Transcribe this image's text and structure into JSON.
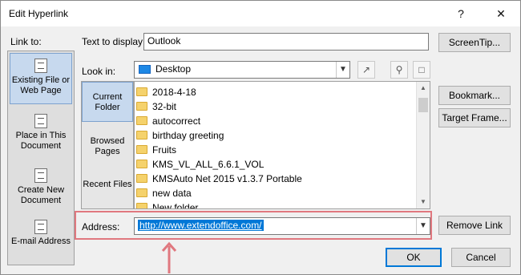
{
  "window": {
    "title": "Edit Hyperlink",
    "help_label": "?",
    "close_label": "✕"
  },
  "link_to": {
    "header": "Link to:",
    "items": [
      {
        "label": "Existing File or Web Page",
        "icon": "web-page-icon",
        "selected": true
      },
      {
        "label": "Place in This Document",
        "icon": "document-place-icon",
        "selected": false
      },
      {
        "label": "Create New Document",
        "icon": "new-document-icon",
        "selected": false
      },
      {
        "label": "E-mail Address",
        "icon": "email-icon",
        "selected": false
      }
    ]
  },
  "text_to_display": {
    "label": "Text to display:",
    "value": "Outlook"
  },
  "screentip_button": "ScreenTip...",
  "look_in": {
    "label": "Look in:",
    "value": "Desktop",
    "icon": "desktop-icon"
  },
  "browse_tabs": [
    {
      "label": "Current Folder",
      "selected": true
    },
    {
      "label": "Browsed Pages",
      "selected": false
    },
    {
      "label": "Recent Files",
      "selected": false
    }
  ],
  "files": [
    "2018-4-18",
    "32-bit",
    "autocorrect",
    "birthday greeting",
    "Fruits",
    "KMS_VL_ALL_6.6.1_VOL",
    "KMSAuto Net 2015 v1.3.7 Portable",
    "new data",
    "New folder"
  ],
  "right_buttons": {
    "bookmark": "Bookmark...",
    "target_frame": "Target Frame...",
    "remove_link": "Remove Link"
  },
  "address": {
    "label": "Address:",
    "value": "http://www.extendoffice.com/"
  },
  "footer": {
    "ok": "OK",
    "cancel": "Cancel"
  },
  "colors": {
    "accent": "#0078d7",
    "highlight_annotation": "#e0787f"
  }
}
